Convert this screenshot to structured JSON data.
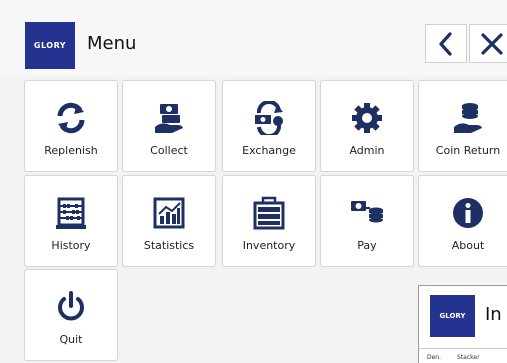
{
  "header": {
    "logo_text": "GLORY",
    "title": "Menu",
    "back_icon": "chevron-left-icon",
    "close_icon": "close-icon"
  },
  "colors": {
    "brand": "#23338f",
    "icon": "#1e3063",
    "tile_border": "#d7d7d7"
  },
  "tiles": [
    {
      "label": "Replenish",
      "icon": "refresh-icon"
    },
    {
      "label": "Collect",
      "icon": "hand-money-icon"
    },
    {
      "label": "Exchange",
      "icon": "exchange-icon"
    },
    {
      "label": "Admin",
      "icon": "gear-icon"
    },
    {
      "label": "Coin Return",
      "icon": "coins-hand-icon"
    },
    {
      "label": "History",
      "icon": "abacus-icon"
    },
    {
      "label": "Statistics",
      "icon": "chart-icon"
    },
    {
      "label": "Inventory",
      "icon": "safe-icon"
    },
    {
      "label": "Pay",
      "icon": "pay-icon"
    },
    {
      "label": "About",
      "icon": "info-icon"
    },
    {
      "label": "Quit",
      "icon": "power-icon"
    }
  ],
  "sub_window": {
    "logo_text": "GLORY",
    "title_partial": "In",
    "col_1": "Den.",
    "col_2": "Stacker"
  }
}
